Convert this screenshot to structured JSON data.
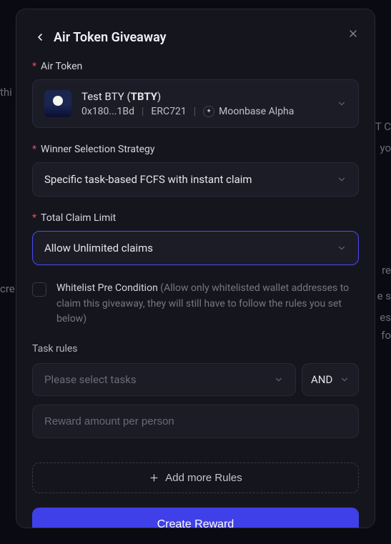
{
  "bg": {
    "t1": "thi",
    "t2": "cre",
    "t3": "T C",
    "t4": "yo",
    "t5": "re",
    "t6": "e s",
    "t7": "es",
    "t8": "fo"
  },
  "modal": {
    "title": "Air Token Giveaway"
  },
  "airToken": {
    "label": "Air Token",
    "name": "Test BTY",
    "symbol": "TBTY",
    "address": "0x180...1Bd",
    "standard": "ERC721",
    "network": "Moonbase Alpha"
  },
  "winnerStrategy": {
    "label": "Winner Selection Strategy",
    "value": "Specific task-based FCFS with instant claim"
  },
  "claimLimit": {
    "label": "Total Claim Limit",
    "value": "Allow Unlimited claims"
  },
  "whitelist": {
    "label": "Whitelist Pre Condition",
    "hint": "(Allow only whitelisted wallet addresses to claim this giveaway, they will still have to follow the rules you set below)"
  },
  "taskRules": {
    "label": "Task rules",
    "selectPlaceholder": "Please select tasks",
    "logic": "AND",
    "rewardPlaceholder": "Reward amount per person"
  },
  "buttons": {
    "addMore": "Add more Rules",
    "create": "Create Reward"
  }
}
